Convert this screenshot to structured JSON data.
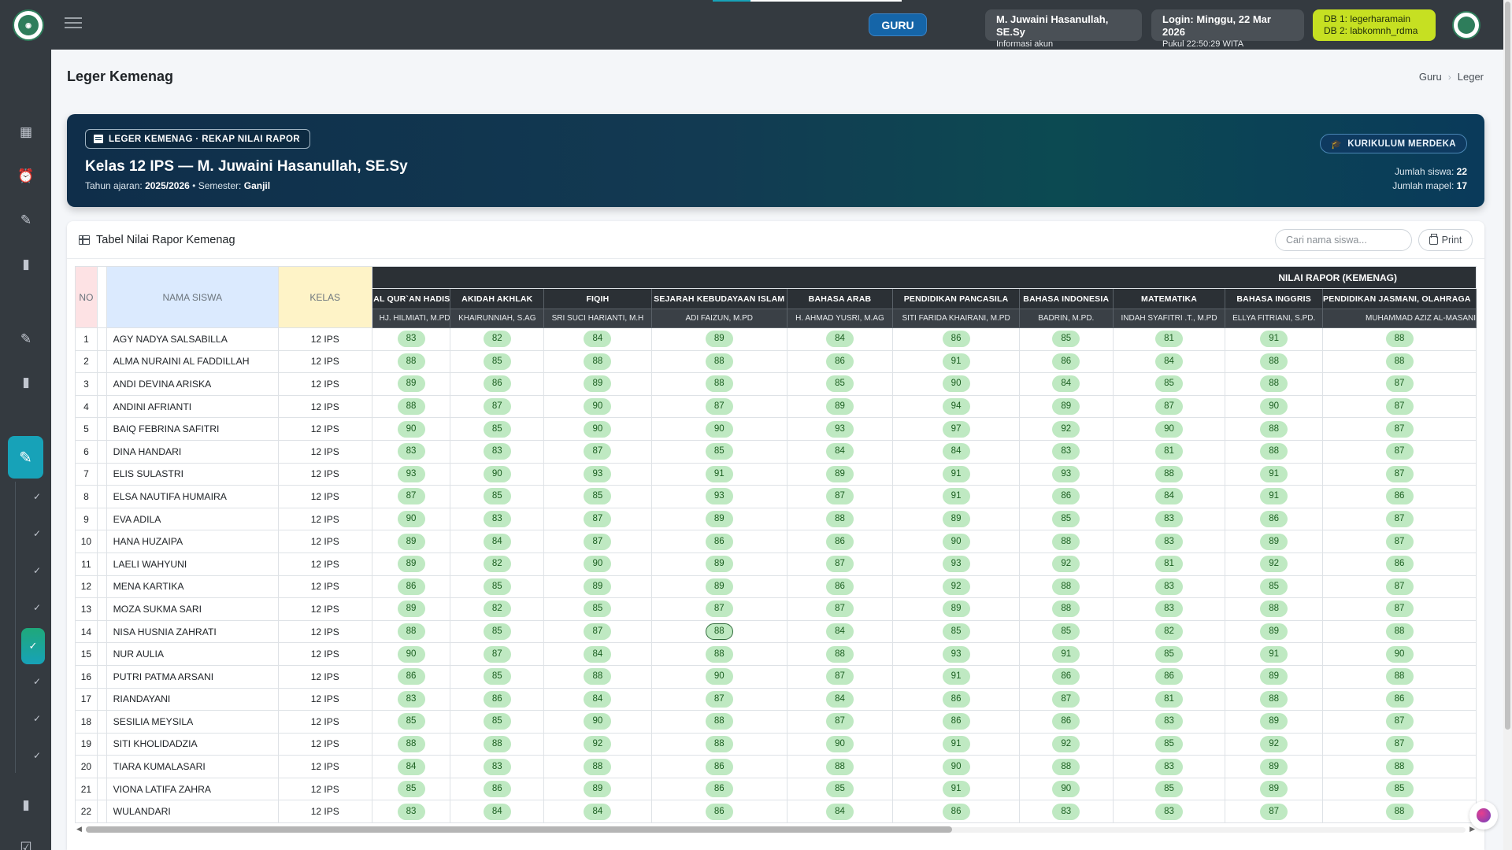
{
  "topbar": {
    "role_badge": "GURU",
    "user_name": "M. Juwaini Hasanullah, SE.Sy",
    "user_sub": "Informasi akun",
    "login_line": "Login: Minggu, 22 Mar 2026",
    "clock_line": "Pukul 22:50:29 WITA",
    "db1": "DB 1: legerharamain",
    "db2": "DB 2: labkomnh_rdma"
  },
  "page": {
    "title": "Leger Kemenag",
    "breadcrumb": [
      "Guru",
      "Leger"
    ]
  },
  "hero": {
    "chip": "LEGER KEMENAG · REKAP NILAI RAPOR",
    "title": "Kelas 12 IPS — M. Juwaini Hasanullah, SE.Sy",
    "tahun_label": "Tahun ajaran:",
    "tahun_value": "2025/2026",
    "semester_label": "• Semester:",
    "semester_value": "Ganjil",
    "kurikulum": "KURIKULUM MERDEKA",
    "jumlah_siswa_label": "Jumlah siswa:",
    "jumlah_siswa": "22",
    "jumlah_mapel_label": "Jumlah mapel:",
    "jumlah_mapel": "17"
  },
  "card": {
    "title": "Tabel Nilai Rapor Kemenag",
    "search_placeholder": "Cari nama siswa...",
    "print_label": "Print"
  },
  "table": {
    "col_no": "NO",
    "col_nama": "NAMA SISWA",
    "col_kelas": "KELAS",
    "group_label": "NILAI RAPOR (KEMENAG)",
    "subjects": [
      {
        "name": "AL QUR`AN HADIS",
        "teacher": "HJ. HILMIATI, M.PD"
      },
      {
        "name": "AKIDAH AKHLAK",
        "teacher": "KHAIRUNNIAH, S.AG"
      },
      {
        "name": "FIQIH",
        "teacher": "SRI SUCI HARIANTI, M.H"
      },
      {
        "name": "SEJARAH KEBUDAYAAN ISLAM",
        "teacher": "ADI FAIZUN, M.PD"
      },
      {
        "name": "BAHASA ARAB",
        "teacher": "H. AHMAD YUSRI, M.AG"
      },
      {
        "name": "PENDIDIKAN PANCASILA",
        "teacher": "SITI FARIDA KHAIRANI, M.PD"
      },
      {
        "name": "BAHASA INDONESIA",
        "teacher": "BADRIN, M.PD."
      },
      {
        "name": "MATEMATIKA",
        "teacher": "INDAH SYAFITRI .T., M.PD"
      },
      {
        "name": "BAHASA INGGRIS",
        "teacher": "ELLYA FITRIANI, S.PD."
      },
      {
        "name": "PENDIDIKAN JASMANI, OLAHRAGA",
        "teacher": "MUHAMMAD AZIZ AL-MASANI"
      }
    ],
    "rows": [
      {
        "no": "1",
        "nama": "AGY NADYA SALSABILLA",
        "kelas": "12 IPS",
        "scores": [
          "83",
          "82",
          "84",
          "89",
          "84",
          "86",
          "85",
          "81",
          "91",
          "88"
        ]
      },
      {
        "no": "2",
        "nama": "ALMA NURAINI AL FADDILLAH",
        "kelas": "12 IPS",
        "scores": [
          "88",
          "85",
          "88",
          "88",
          "86",
          "91",
          "86",
          "84",
          "88",
          "88"
        ]
      },
      {
        "no": "3",
        "nama": "ANDI DEVINA ARISKA",
        "kelas": "12 IPS",
        "scores": [
          "89",
          "86",
          "89",
          "88",
          "85",
          "90",
          "84",
          "85",
          "88",
          "87"
        ]
      },
      {
        "no": "4",
        "nama": "ANDINI AFRIANTI",
        "kelas": "12 IPS",
        "scores": [
          "88",
          "87",
          "90",
          "87",
          "89",
          "94",
          "89",
          "87",
          "90",
          "87"
        ]
      },
      {
        "no": "5",
        "nama": "BAIQ FEBRINA SAFITRI",
        "kelas": "12 IPS",
        "scores": [
          "90",
          "85",
          "90",
          "90",
          "93",
          "97",
          "92",
          "90",
          "88",
          "87"
        ]
      },
      {
        "no": "6",
        "nama": "DINA HANDARI",
        "kelas": "12 IPS",
        "scores": [
          "83",
          "83",
          "87",
          "85",
          "84",
          "84",
          "83",
          "81",
          "88",
          "87"
        ]
      },
      {
        "no": "7",
        "nama": "ELIS SULASTRI",
        "kelas": "12 IPS",
        "scores": [
          "93",
          "90",
          "93",
          "91",
          "89",
          "91",
          "93",
          "88",
          "91",
          "87"
        ]
      },
      {
        "no": "8",
        "nama": "ELSA NAUTIFA HUMAIRA",
        "kelas": "12 IPS",
        "scores": [
          "87",
          "85",
          "85",
          "93",
          "87",
          "91",
          "86",
          "84",
          "91",
          "86"
        ]
      },
      {
        "no": "9",
        "nama": "EVA ADILA",
        "kelas": "12 IPS",
        "scores": [
          "90",
          "83",
          "87",
          "89",
          "88",
          "89",
          "85",
          "83",
          "86",
          "87"
        ]
      },
      {
        "no": "10",
        "nama": "HANA HUZAIPA",
        "kelas": "12 IPS",
        "scores": [
          "89",
          "84",
          "87",
          "86",
          "86",
          "90",
          "88",
          "83",
          "89",
          "87"
        ]
      },
      {
        "no": "11",
        "nama": "LAELI WAHYUNI",
        "kelas": "12 IPS",
        "scores": [
          "89",
          "82",
          "90",
          "89",
          "87",
          "93",
          "92",
          "81",
          "92",
          "86"
        ]
      },
      {
        "no": "12",
        "nama": "MENA KARTIKA",
        "kelas": "12 IPS",
        "scores": [
          "86",
          "85",
          "89",
          "89",
          "86",
          "92",
          "88",
          "83",
          "85",
          "87"
        ]
      },
      {
        "no": "13",
        "nama": "MOZA SUKMA SARI",
        "kelas": "12 IPS",
        "scores": [
          "89",
          "82",
          "85",
          "87",
          "87",
          "89",
          "88",
          "83",
          "88",
          "87"
        ]
      },
      {
        "no": "14",
        "nama": "NISA HUSNIA ZAHRATI",
        "kelas": "12 IPS",
        "scores": [
          "88",
          "85",
          "87",
          "88",
          "84",
          "85",
          "85",
          "82",
          "89",
          "88"
        ]
      },
      {
        "no": "15",
        "nama": "NUR AULIA",
        "kelas": "12 IPS",
        "scores": [
          "90",
          "87",
          "84",
          "88",
          "88",
          "93",
          "91",
          "85",
          "91",
          "90"
        ]
      },
      {
        "no": "16",
        "nama": "PUTRI PATMA ARSANI",
        "kelas": "12 IPS",
        "scores": [
          "86",
          "85",
          "88",
          "90",
          "87",
          "91",
          "86",
          "86",
          "89",
          "88"
        ]
      },
      {
        "no": "17",
        "nama": "RIANDAYANI",
        "kelas": "12 IPS",
        "scores": [
          "83",
          "86",
          "84",
          "87",
          "84",
          "86",
          "87",
          "81",
          "88",
          "86"
        ]
      },
      {
        "no": "18",
        "nama": "SESILIA MEYSILA",
        "kelas": "12 IPS",
        "scores": [
          "85",
          "85",
          "90",
          "88",
          "87",
          "86",
          "86",
          "83",
          "89",
          "87"
        ]
      },
      {
        "no": "19",
        "nama": "SITI KHOLIDADZIA",
        "kelas": "12 IPS",
        "scores": [
          "88",
          "88",
          "92",
          "88",
          "90",
          "91",
          "92",
          "85",
          "92",
          "87"
        ]
      },
      {
        "no": "20",
        "nama": "TIARA KUMALASARI",
        "kelas": "12 IPS",
        "scores": [
          "84",
          "83",
          "88",
          "86",
          "88",
          "90",
          "88",
          "83",
          "89",
          "88"
        ]
      },
      {
        "no": "21",
        "nama": "VIONA LATIFA ZAHRA",
        "kelas": "12 IPS",
        "scores": [
          "85",
          "86",
          "89",
          "86",
          "85",
          "91",
          "90",
          "85",
          "89",
          "85"
        ]
      },
      {
        "no": "22",
        "nama": "WULANDARI",
        "kelas": "12 IPS",
        "scores": [
          "83",
          "84",
          "84",
          "86",
          "84",
          "86",
          "83",
          "83",
          "87",
          "88"
        ]
      }
    ]
  },
  "colors": {
    "sidebar": "#343a40",
    "accent": "#17a2b8",
    "guru_badge": "#1565a8",
    "db_badge": "#c6e022",
    "score_pill": "#bfe9c2"
  },
  "icons": [
    "menu-icon",
    "dashboard-icon",
    "alarm-icon",
    "user-edit-icon",
    "book-icon",
    "pencil-icon",
    "check-icon",
    "table-icon",
    "print-icon",
    "graduation-cap-icon"
  ]
}
